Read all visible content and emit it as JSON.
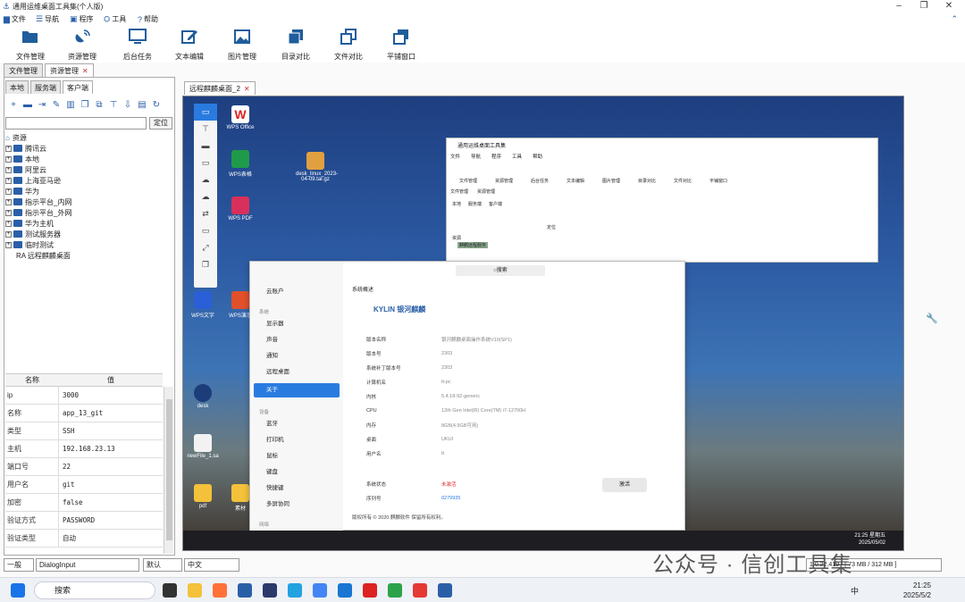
{
  "app": {
    "title": "通用运维桌面工具集(个人版)"
  },
  "menu": [
    {
      "icon": "file-icon",
      "label": "文件"
    },
    {
      "icon": "list-icon",
      "label": "导航"
    },
    {
      "icon": "program-icon",
      "label": "程序"
    },
    {
      "icon": "toolbox-icon",
      "label": "工具"
    },
    {
      "icon": "help-icon",
      "label": "帮助"
    }
  ],
  "toolbar": [
    {
      "icon": "folder-open-icon",
      "label": "文件管理"
    },
    {
      "icon": "satellite-icon",
      "label": "资源管理"
    },
    {
      "icon": "monitor-icon",
      "label": "后台任务"
    },
    {
      "icon": "edit-icon",
      "label": "文本编辑"
    },
    {
      "icon": "image-icon",
      "label": "图片管理"
    },
    {
      "icon": "copy-icon",
      "label": "目录对比"
    },
    {
      "icon": "compare-icon",
      "label": "文件对比"
    },
    {
      "icon": "tile-window-icon",
      "label": "平铺窗口"
    }
  ],
  "main_tabs": [
    {
      "label": "文件管理"
    },
    {
      "label": "资源管理",
      "closable": true
    }
  ],
  "sub_tabs": [
    "本地",
    "服务端",
    "客户端"
  ],
  "search": {
    "value": "",
    "locate_label": "定位"
  },
  "tree": {
    "root": "资源",
    "groups": [
      "腾讯云",
      "本地",
      "阿里云",
      "上海亚马逊",
      "华为",
      "指示平台_内网",
      "指示平台_外网",
      "华为主机",
      "测试服务器",
      "临时测试"
    ],
    "leaf": "RA 远程麒麟桌面"
  },
  "props": {
    "headers": [
      "名称",
      "值"
    ],
    "rows": [
      [
        "ip",
        "3000"
      ],
      [
        "名称",
        "app_13_git"
      ],
      [
        "类型",
        "SSH"
      ],
      [
        "主机",
        "192.168.23.13"
      ],
      [
        "端口号",
        "22"
      ],
      [
        "用户名",
        "git"
      ],
      [
        "加密",
        "false"
      ],
      [
        "验证方式",
        "PASSWORD"
      ],
      [
        "验证类型",
        "自动"
      ]
    ]
  },
  "remote_tab": {
    "label": "远程麒麟桌面_2"
  },
  "remote_desktop": {
    "icons": [
      "WPS Office",
      "WPS表格",
      "WPS PDF",
      "WPS文字",
      "WPS演示",
      "desk",
      "newFile_1.sa",
      "pdf",
      "素材"
    ],
    "file_icon": "desk_linux_2023-04-09.tar.gz",
    "inner_app": {
      "title": "通用运维桌面工具集",
      "menu": [
        "文件",
        "导航",
        "程序",
        "工具",
        "帮助"
      ],
      "toolbar": [
        "文件管理",
        "资源管理",
        "后台任务",
        "文本编辑",
        "图片管理",
        "目录对比",
        "文件对比",
        "平铺窗口"
      ],
      "tabs": [
        "文件管理",
        "资源管理"
      ],
      "sub_tabs": [
        "本地",
        "服务端",
        "客户端"
      ],
      "locate": "定位",
      "root": "资源",
      "highlighted": "麒麟远程服务"
    },
    "settings": {
      "search_placeholder": "搜索",
      "account": "云账户",
      "group_system": "系统",
      "system_items": [
        "显示器",
        "声音",
        "通知",
        "远程桌面",
        "关于"
      ],
      "group_device": "设备",
      "device_items": [
        "蓝牙",
        "打印机",
        "鼠标",
        "键盘",
        "快捷键",
        "多屏协同"
      ],
      "group_other": "网络",
      "section_title": "系统概述",
      "brand": "KYLIN 银河麒麟",
      "info": [
        [
          "版本名称",
          "银河麒麟桌面操作系统V10(SP1)"
        ],
        [
          "版本号",
          "2303"
        ],
        [
          "系统补丁版本号",
          "2303"
        ],
        [
          "计算机名",
          "tt-pc"
        ],
        [
          "内核",
          "5.4.18-92-generic"
        ],
        [
          "CPU",
          "12th Gen Intel(R) Core(TM) i7-12700H"
        ],
        [
          "内存",
          "8GB(4.9GB可用)"
        ],
        [
          "桌面",
          "UKUI"
        ],
        [
          "用户名",
          "tt"
        ]
      ],
      "activation_label": "系统状态",
      "activation_value": "未激活",
      "serial_label": "序列号",
      "serial_value": "0279935",
      "activate_button": "激活",
      "copyright": "版权所有 © 2020 麒麟软件 保留所有权利。"
    },
    "taskbar_time": "21:25 星期五",
    "taskbar_date": "2025/05/02"
  },
  "statusbar": {
    "level": "一般",
    "input": "DialogInput",
    "theme": "默认",
    "lang": "中文",
    "version": "1.0.22.419 - [ 73 MB / 312 MB ]"
  },
  "watermark": "公众号 · 信创工具集",
  "win_taskbar": {
    "search": "搜索",
    "ime": "中",
    "time": "21:25",
    "date": "2025/5/2"
  },
  "colors": {
    "accent": "#2a5fa8",
    "active_item": "#2a7be0",
    "warning": "#e03030"
  }
}
